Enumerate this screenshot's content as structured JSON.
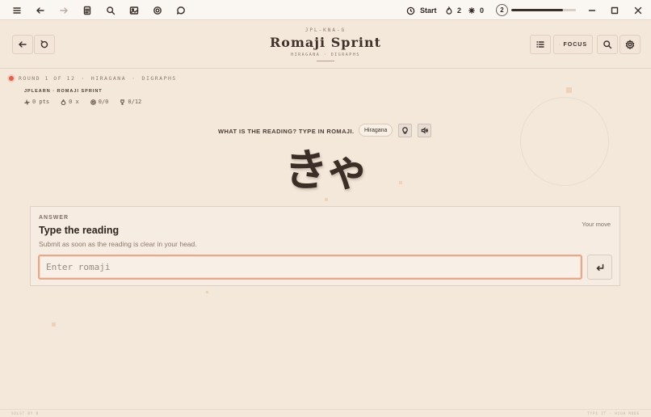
{
  "chrome": {
    "icons": [
      "menu-icon",
      "back-arrow-icon",
      "forward-arrow-icon",
      "document-icon",
      "search-icon",
      "image-icon",
      "settings-icon",
      "chat-icon"
    ],
    "start_label": "Start",
    "streak_count": "2",
    "sparkle_count": "0",
    "level": "2",
    "progress_fraction": 0.8
  },
  "header": {
    "code": "JPL-KNA-G",
    "title": "Romaji Sprint",
    "subtitle": "HIRAGANA · DIGRAPHS",
    "focus_label": "FOCUS"
  },
  "round": {
    "label": "ROUND 1 OF 12",
    "script": "HIRAGANA",
    "set": "DIGRAPHS",
    "breadcrumb": "JPLEARN · ROMAJI SPRINT",
    "points": "0 pts",
    "streak": "0 x",
    "accuracy": "0/0",
    "best": "0/12"
  },
  "prompt": {
    "question": "WHAT IS THE READING? TYPE IN ROMAJI.",
    "script_badge": "Hiragana",
    "kana": "きゃ"
  },
  "answer": {
    "overline": "ANSWER",
    "title": "Type the reading",
    "hint": "Submit as soon as the reading is clear in your head.",
    "status": "Your move",
    "placeholder": "Enter romaji",
    "value": ""
  },
  "footer": {
    "left": "SOLST BY B",
    "right": "TYPE IT · HIGH MODE"
  },
  "colors": {
    "background": "#f4e8da",
    "accent": "#e0604d",
    "input_focus": "#e3a88e",
    "ink": "#3b2e27"
  }
}
